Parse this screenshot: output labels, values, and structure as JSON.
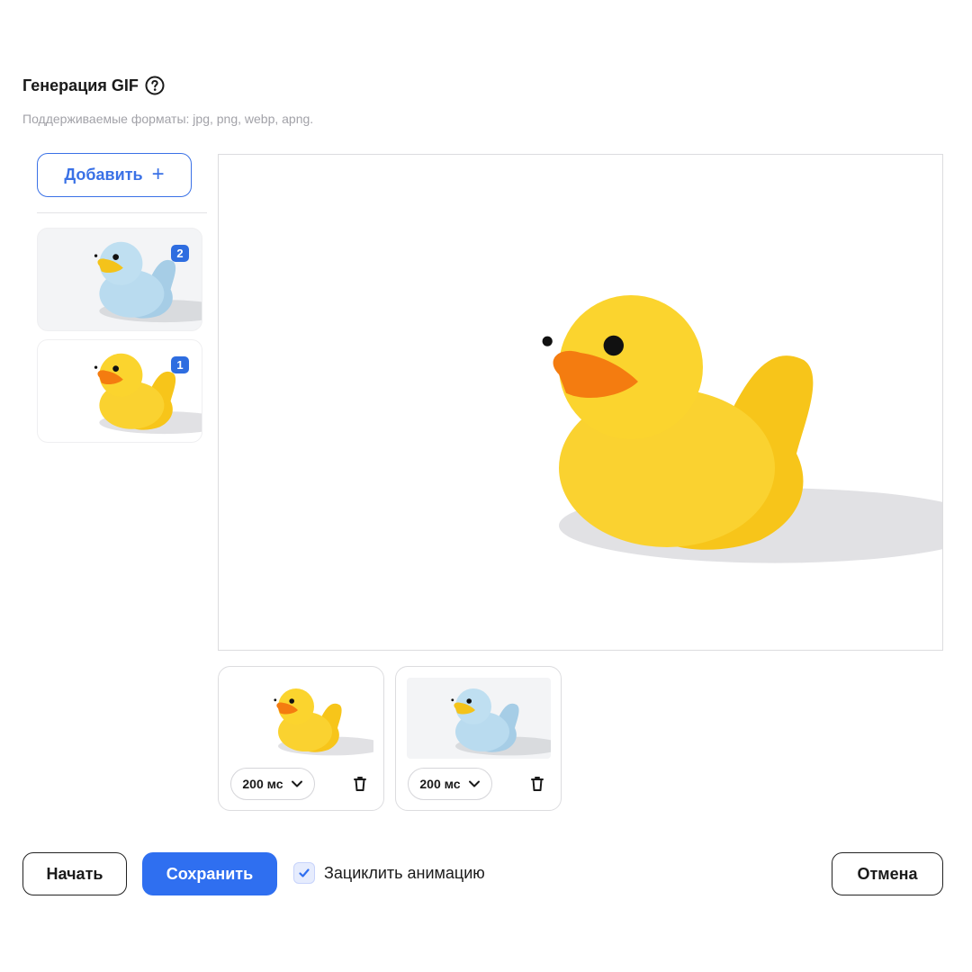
{
  "header": {
    "title": "Генерация GIF",
    "help_icon": "question-circle-icon",
    "subtitle": "Поддерживаемые форматы: jpg, png, webp, apng."
  },
  "sidebar": {
    "add_label": "Добавить",
    "add_icon": "plus-icon",
    "frames": [
      {
        "badge": "2",
        "duck_color": "light-blue"
      },
      {
        "badge": "1",
        "duck_color": "yellow"
      }
    ]
  },
  "preview": {
    "duck_color": "yellow"
  },
  "frames": [
    {
      "delay": "200 мс",
      "duck_color": "yellow",
      "delete_icon": "trash-icon"
    },
    {
      "delay": "200 мс",
      "duck_color": "light-blue",
      "delete_icon": "trash-icon"
    }
  ],
  "footer": {
    "start_label": "Начать",
    "save_label": "Сохранить",
    "loop_label": "Зациклить анимацию",
    "loop_checked": true,
    "cancel_label": "Отмена"
  },
  "colors": {
    "accent": "#2f6ff0",
    "badge": "#2e6de0",
    "duck_yellow": "#f9cc1c",
    "duck_blue": "#b5d7ec",
    "beak_orange": "#f27a12"
  }
}
